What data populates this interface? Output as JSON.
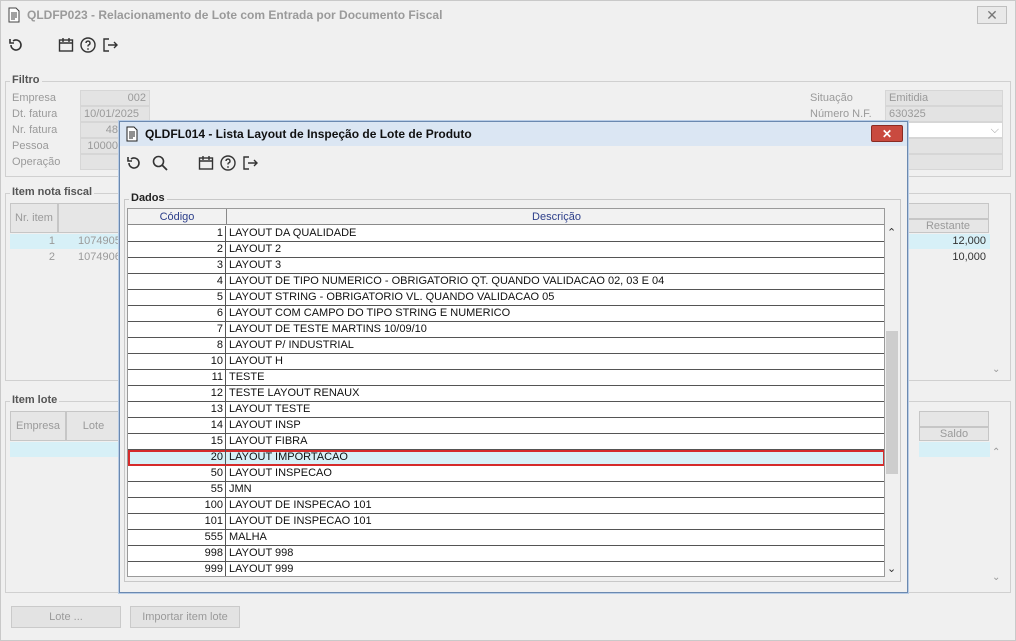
{
  "main": {
    "title": "QLDFP023 - Relacionamento de Lote com Entrada por Documento Fiscal",
    "close": "✕",
    "filtro": {
      "label": "Filtro",
      "empresa_label": "Empresa",
      "empresa_value": "002",
      "dt_fatura_label": "Dt. fatura",
      "dt_fatura_value": "10/01/2025",
      "nr_fatura_label": "Nr. fatura",
      "nr_fatura_value": "48",
      "pessoa_label": "Pessoa",
      "pessoa_value": "10000",
      "operacao_label": "Operação",
      "situacao_label": "Situação",
      "situacao_value": "Emitidia",
      "numero_nf_label": "Número N.F.",
      "numero_nf_value": "630325"
    },
    "item_nota": {
      "label": "Item nota fiscal",
      "col_nr_item": "Nr. item",
      "col_restante": "Restante",
      "rows": [
        {
          "nr": "1",
          "item": "1074905",
          "restante": "12,000"
        },
        {
          "nr": "2",
          "item": "1074906",
          "restante": "10,000"
        }
      ]
    },
    "item_lote": {
      "label": "Item lote",
      "col_empresa": "Empresa",
      "col_lote": "Lote",
      "col_saldo": "Saldo"
    },
    "buttons": {
      "lote": "Lote ...",
      "importar": "Importar item lote"
    }
  },
  "dialog": {
    "title": "QLDFL014 - Lista Layout de Inspeção de Lote de Produto",
    "close": "✕",
    "dados_label": "Dados",
    "col_codigo": "Código",
    "col_descricao": "Descrição",
    "rows": [
      {
        "code": "1",
        "desc": "LAYOUT DA QUALIDADE"
      },
      {
        "code": "2",
        "desc": "LAYOUT 2"
      },
      {
        "code": "3",
        "desc": "LAYOUT 3"
      },
      {
        "code": "4",
        "desc": "LAYOUT DE TIPO NUMERICO - OBRIGATORIO QT. QUANDO VALIDACAO 02, 03 E 04"
      },
      {
        "code": "5",
        "desc": "LAYOUT STRING - OBRIGATORIO VL. QUANDO VALIDACAO 05"
      },
      {
        "code": "6",
        "desc": "LAYOUT COM CAMPO DO TIPO STRING E NUMERICO"
      },
      {
        "code": "7",
        "desc": "LAYOUT DE TESTE MARTINS 10/09/10"
      },
      {
        "code": "8",
        "desc": "LAYOUT P/ INDUSTRIAL"
      },
      {
        "code": "10",
        "desc": "LAYOUT H"
      },
      {
        "code": "11",
        "desc": "TESTE"
      },
      {
        "code": "12",
        "desc": "TESTE LAYOUT RENAUX"
      },
      {
        "code": "13",
        "desc": "LAYOUT TESTE"
      },
      {
        "code": "14",
        "desc": "LAYOUT INSP"
      },
      {
        "code": "15",
        "desc": "LAYOUT FIBRA"
      },
      {
        "code": "20",
        "desc": "LAYOUT IMPORTACAO"
      },
      {
        "code": "50",
        "desc": "LAYOUT INSPECAO"
      },
      {
        "code": "55",
        "desc": "JMN"
      },
      {
        "code": "100",
        "desc": "LAYOUT DE INSPECAO 101"
      },
      {
        "code": "101",
        "desc": "LAYOUT DE INSPECAO 101"
      },
      {
        "code": "555",
        "desc": "MALHA"
      },
      {
        "code": "998",
        "desc": "LAYOUT 998"
      },
      {
        "code": "999",
        "desc": "LAYOUT 999"
      }
    ],
    "selected_index": 14
  },
  "icons": {
    "toolbar": [
      "undo-icon",
      "calendar-icon",
      "help-icon",
      "exit-icon"
    ],
    "dialog_toolbar": [
      "undo-icon",
      "search-icon",
      "calendar-icon",
      "help-icon",
      "exit-icon"
    ]
  },
  "colors": {
    "selected_row_bg": "#d7f0f7",
    "selected_row_border": "#d52b2b",
    "dialog_close_bg": "#c94a3f",
    "header_text": "#2c3e8a"
  }
}
